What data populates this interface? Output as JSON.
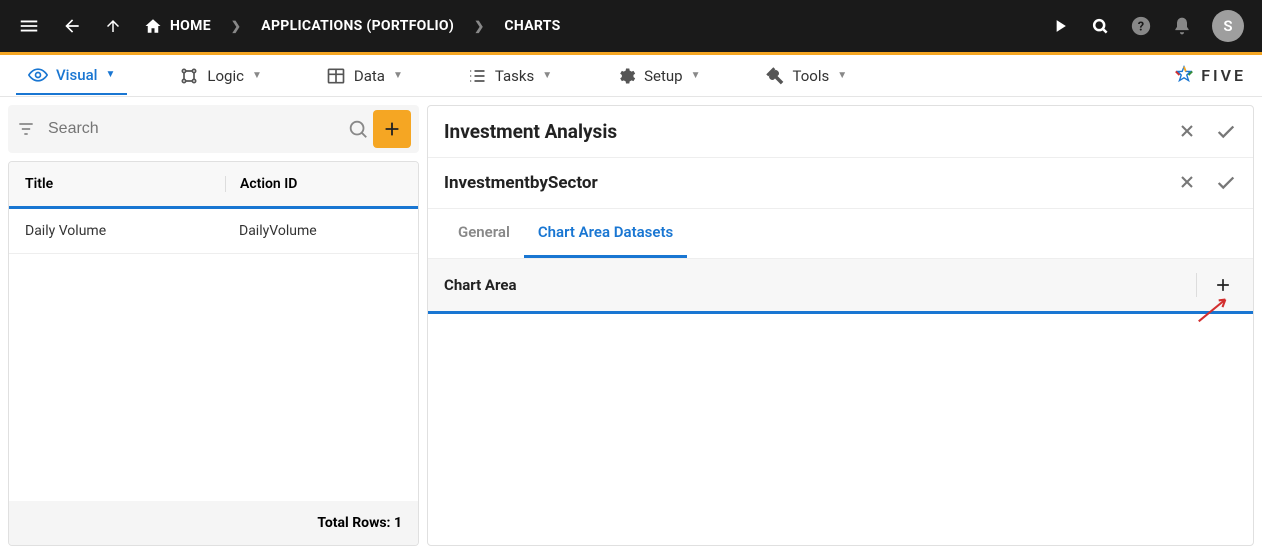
{
  "topbar": {
    "home_label": "HOME",
    "bc_app": "APPLICATIONS (PORTFOLIO)",
    "bc_charts": "CHARTS",
    "avatar_letter": "S"
  },
  "tabs": {
    "visual": "Visual",
    "logic": "Logic",
    "data": "Data",
    "tasks": "Tasks",
    "setup": "Setup",
    "tools": "Tools"
  },
  "brand": "FIVE",
  "search": {
    "placeholder": "Search"
  },
  "table": {
    "header_title": "Title",
    "header_action": "Action ID",
    "rows": [
      {
        "title": "Daily Volume",
        "action_id": "DailyVolume"
      }
    ],
    "total_label": "Total Rows: 1"
  },
  "right": {
    "title1": "Investment Analysis",
    "title2": "InvestmentbySector",
    "subtab_general": "General",
    "subtab_datasets": "Chart Area Datasets",
    "chart_area_label": "Chart Area"
  }
}
